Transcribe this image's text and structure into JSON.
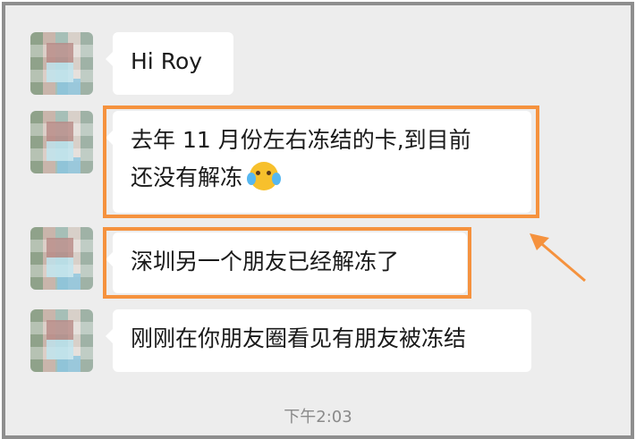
{
  "messages": [
    {
      "text": "Hi Roy"
    },
    {
      "text_line1": "去年 11 月份左右冻结的卡,到目前",
      "text_line2": "还没有解冻"
    },
    {
      "text": "深圳另一个朋友已经解冻了"
    },
    {
      "text": "刚刚在你朋友圈看见有朋友被冻结"
    }
  ],
  "timestamp": "下午2:03",
  "colors": {
    "highlight": "#f5923e",
    "chat_bg": "#ededed",
    "bubble": "#ffffff"
  },
  "icons": {
    "emoji": "crying-laughing-emoji"
  }
}
